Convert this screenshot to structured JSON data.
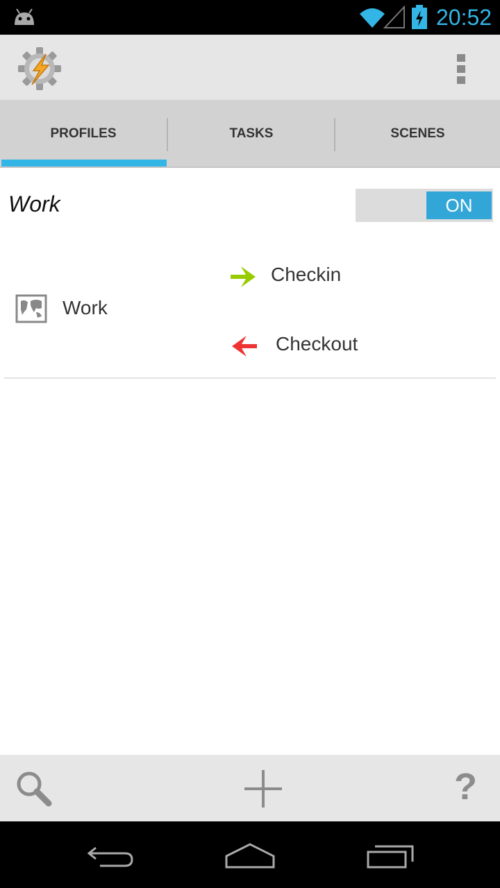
{
  "status_bar": {
    "time": "20:52"
  },
  "tabs": [
    {
      "label": "PROFILES",
      "selected": true
    },
    {
      "label": "TASKS",
      "selected": false
    },
    {
      "label": "SCENES",
      "selected": false
    }
  ],
  "profile": {
    "name": "Work",
    "toggle_label": "ON",
    "context": "Work",
    "enter_task": "Checkin",
    "exit_task": "Checkout"
  },
  "icons": {
    "app": "tasker-gear-bolt-icon",
    "context": "map-icon",
    "enter": "green-right-arrow-icon",
    "exit": "red-left-arrow-icon",
    "search": "search-icon",
    "add": "plus-icon",
    "help": "question-icon"
  },
  "bottom_bar": {
    "help_glyph": "?"
  },
  "colors": {
    "accent": "#33b5e5",
    "enter": "#99cc00",
    "exit": "#ee3333"
  }
}
